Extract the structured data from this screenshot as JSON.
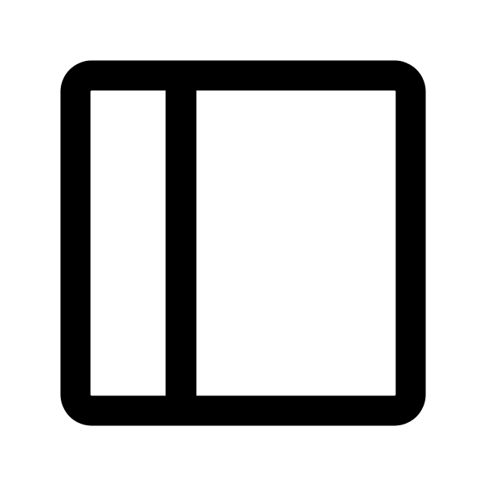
{
  "icon": {
    "name": "sidebar-left-icon",
    "stroke_color": "#000000",
    "fill_color": "#ffffff"
  },
  "background_color": "#ffffff"
}
